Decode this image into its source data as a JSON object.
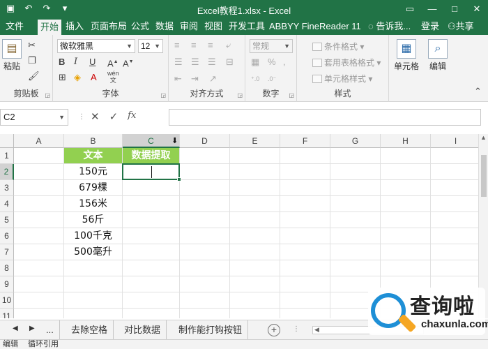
{
  "window": {
    "title": "Excel教程1.xlsx - Excel",
    "accent": "#217346"
  },
  "ribbon_tabs": [
    {
      "label": "文件",
      "active": false
    },
    {
      "label": "开始",
      "active": true
    },
    {
      "label": "插入",
      "active": false
    },
    {
      "label": "页面布局",
      "active": false
    },
    {
      "label": "公式",
      "active": false
    },
    {
      "label": "数据",
      "active": false
    },
    {
      "label": "审阅",
      "active": false
    },
    {
      "label": "视图",
      "active": false
    },
    {
      "label": "开发工具",
      "active": false
    },
    {
      "label": "ABBYY FineReader 11",
      "active": false
    }
  ],
  "tell_me": "告诉我...",
  "sign_in": "登录",
  "share": "共享",
  "ribbon": {
    "clipboard": {
      "paste": "粘贴",
      "label": "剪贴板"
    },
    "font": {
      "name": "微软雅黑",
      "size": "12",
      "label": "字体",
      "bold": "B",
      "italic": "I",
      "underline": "U",
      "wen": "wén"
    },
    "alignment": {
      "label": "对齐方式"
    },
    "number": {
      "format": "常规",
      "label": "数字",
      "percent": "%"
    },
    "styles": {
      "conditional": "条件格式",
      "table": "套用表格格式",
      "cell_styles": "单元格样式",
      "label": "样式"
    },
    "cells": {
      "label": "单元格"
    },
    "editing": {
      "label": "编辑"
    }
  },
  "formula_bar": {
    "name_box": "C2",
    "fx": "fx",
    "value": ""
  },
  "columns": [
    "A",
    "B",
    "C",
    "D",
    "E",
    "F",
    "G",
    "H",
    "I"
  ],
  "selected_column": "C",
  "rows": [
    "1",
    "2",
    "3",
    "4",
    "5",
    "6",
    "7",
    "8",
    "9",
    "10",
    "11"
  ],
  "selected_row": "2",
  "cells": {
    "B1": "文本",
    "C1": "数据提取",
    "B2": "150元",
    "B3": "679棵",
    "B4": "156米",
    "B5": "56斤",
    "B6": "100千克",
    "B7": "500毫升"
  },
  "header_fill": "#92d050",
  "sheet_tabs": [
    "...",
    "去除空格",
    "对比数据",
    "制作能打钩按钮"
  ],
  "statusbar": {
    "mode": "编辑",
    "circular": "循环引用"
  },
  "watermark": {
    "cn": "查询啦",
    "en": "chaxunla.com"
  }
}
